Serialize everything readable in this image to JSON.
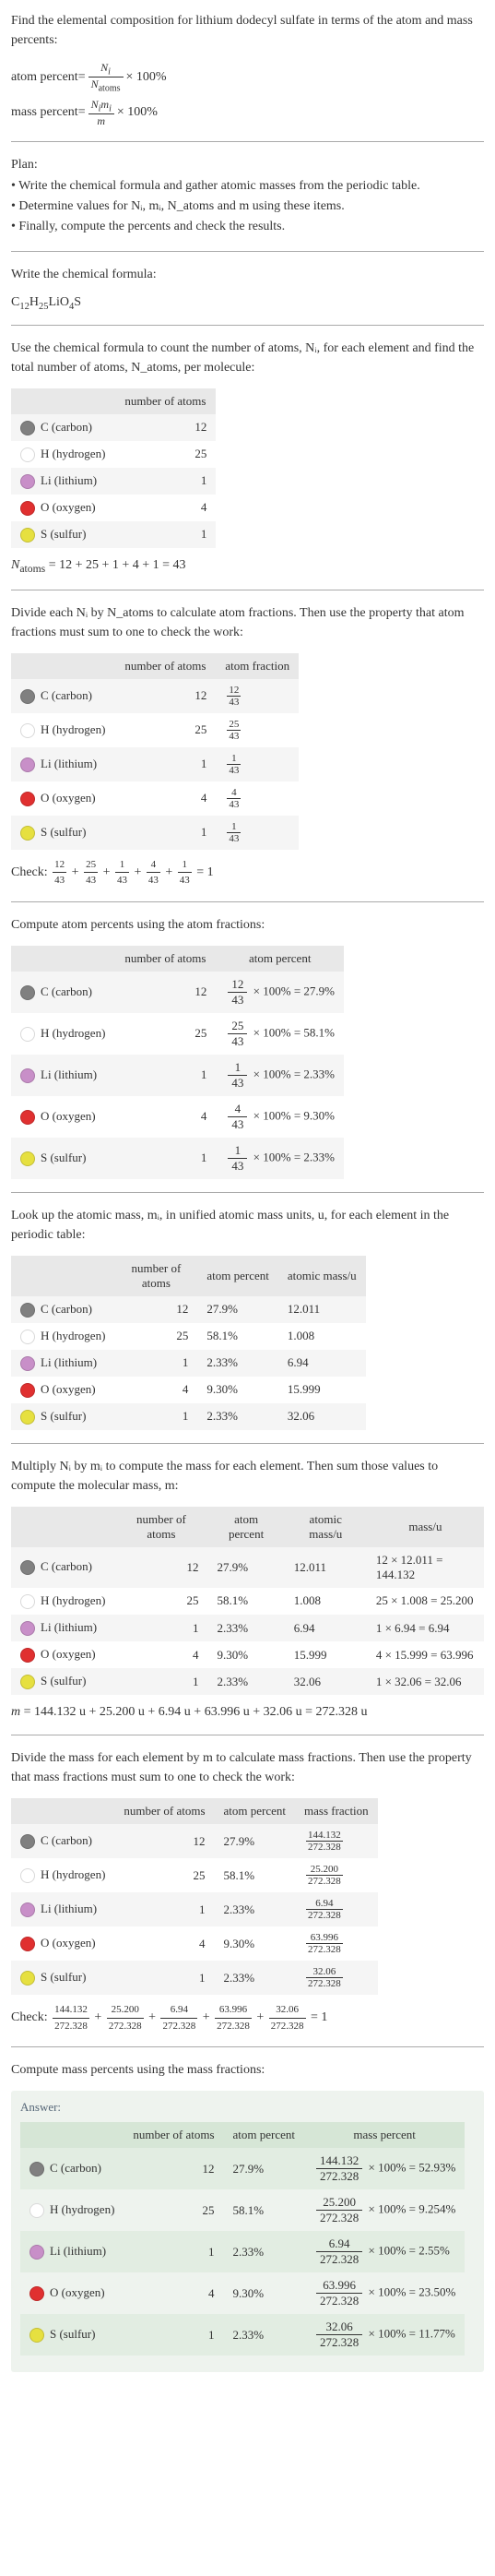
{
  "intro": "Find the elemental composition for lithium dodecyl sulfate in terms of the atom and mass percents:",
  "atom_percent_label": "atom percent",
  "mass_percent_label": "mass percent",
  "eq": " = ",
  "times100": " × 100%",
  "plan_label": "Plan:",
  "plan_items": [
    "• Write the chemical formula and gather atomic masses from the periodic table.",
    "• Determine values for Nᵢ, mᵢ, N_atoms and m using these items.",
    "• Finally, compute the percents and check the results."
  ],
  "write_formula": "Write the chemical formula:",
  "formula_html": "C₁₂H₂₅LiO₄S",
  "count_text": "Use the chemical formula to count the number of atoms, Nᵢ, for each element and find the total number of atoms, N_atoms, per molecule:",
  "headers": {
    "element": "",
    "number_atoms": "number of atoms",
    "atom_fraction": "atom fraction",
    "atom_percent": "atom percent",
    "atomic_mass": "atomic mass/u",
    "mass_u": "mass/u",
    "mass_fraction": "mass fraction",
    "mass_percent": "mass percent"
  },
  "elements": [
    {
      "sym": "C",
      "name": "C (carbon)",
      "color": "#808080",
      "n": 12,
      "frac": "12/43",
      "pct": "27.9%",
      "mass": "12.011",
      "massu": "12 × 12.011 = 144.132",
      "mfrac": "144.132/272.328",
      "mpct": "52.93%",
      "pct1": "27.9%"
    },
    {
      "sym": "H",
      "name": "H (hydrogen)",
      "color": "#ffffff",
      "n": 25,
      "frac": "25/43",
      "pct": "58.1%",
      "mass": "1.008",
      "massu": "25 × 1.008 = 25.200",
      "mfrac": "25.200/272.328",
      "mpct": "9.254%",
      "pct1": "58.1%"
    },
    {
      "sym": "Li",
      "name": "Li (lithium)",
      "color": "#c88fc8",
      "n": 1,
      "frac": "1/43",
      "pct": "2.33%",
      "mass": "6.94",
      "massu": "1 × 6.94 = 6.94",
      "mfrac": "6.94/272.328",
      "mpct": "2.55%",
      "pct1": "2.33%"
    },
    {
      "sym": "O",
      "name": "O (oxygen)",
      "color": "#e03030",
      "n": 4,
      "frac": "4/43",
      "pct": "9.30%",
      "mass": "15.999",
      "massu": "4 × 15.999 = 63.996",
      "mfrac": "63.996/272.328",
      "mpct": "23.50%",
      "pct1": "9.30%"
    },
    {
      "sym": "S",
      "name": "S (sulfur)",
      "color": "#e6e040",
      "n": 1,
      "frac": "1/43",
      "pct": "2.33%",
      "mass": "32.06",
      "massu": "1 × 32.06 = 32.06",
      "mfrac": "32.06/272.328",
      "mpct": "11.77%",
      "pct1": "2.33%"
    }
  ],
  "natoms_eq": "N_atoms = 12 + 25 + 1 + 4 + 1 = 43",
  "divide_text": "Divide each Nᵢ by N_atoms to calculate atom fractions. Then use the property that atom fractions must sum to one to check the work:",
  "check1_label": "Check: ",
  "check1_eq": "12/43 + 25/43 + 1/43 + 4/43 + 1/43 = 1",
  "compute_atom_pct": "Compute atom percents using the atom fractions:",
  "lookup_mass": "Look up the atomic mass, mᵢ, in unified atomic mass units, u, for each element in the periodic table:",
  "multiply_text": "Multiply Nᵢ by mᵢ to compute the mass for each element. Then sum those values to compute the molecular mass, m:",
  "m_eq": "m = 144.132 u + 25.200 u + 6.94 u + 63.996 u + 32.06 u = 272.328 u",
  "divide_mass": "Divide the mass for each element by m to calculate mass fractions. Then use the property that mass fractions must sum to one to check the work:",
  "check2_label": "Check: ",
  "check2_eq": "144.132/272.328 + 25.200/272.328 + 6.94/272.328 + 63.996/272.328 + 32.06/272.328 = 1",
  "compute_mass_pct": "Compute mass percents using the mass fractions:",
  "answer_label": "Answer:",
  "atom_pct_calc": [
    "12/43 × 100% = 27.9%",
    "25/43 × 100% = 58.1%",
    "1/43 × 100% = 2.33%",
    "4/43 × 100% = 9.30%",
    "1/43 × 100% = 2.33%"
  ],
  "mass_pct_calc": [
    "144.132/272.328 × 100% = 52.93%",
    "25.200/272.328 × 100% = 9.254%",
    "6.94/272.328 × 100% = 2.55%",
    "63.996/272.328 × 100% = 23.50%",
    "32.06/272.328 × 100% = 11.77%"
  ]
}
